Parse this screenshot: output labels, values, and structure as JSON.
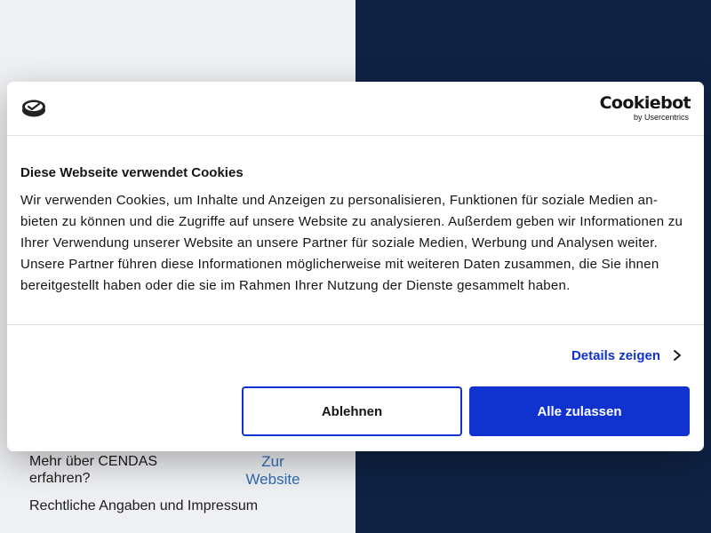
{
  "background": {
    "footer": {
      "more_text": "Mehr über CENDAS erfahren?",
      "website_link": "Zur Website",
      "legal_link": "Rechtliche Angaben und Impressum"
    }
  },
  "cookie_dialog": {
    "brand_logo_icon": "site-logo-icon",
    "cookiebot": {
      "name": "Cookiebot",
      "by": "by Usercentrics"
    },
    "title": "Diese Webseite verwendet Cookies",
    "text": "Wir verwenden Cookies, um Inhalte und Anzeigen zu personalisieren, Funktionen für soziale Medien an­bieten zu können und die Zugriffe auf unsere Website zu analysieren. Außerdem geben wir Informationen zu Ihrer Verwendung unserer Website an unsere Partner für soziale Medien, Werbung und Analysen wei­ter. Unsere Partner führen diese Informationen möglicherweise mit weiteren Daten zusammen, die Sie ih­nen bereitgestellt haben oder die sie im Rahmen Ihrer Nutzung der Dienste gesammelt haben.",
    "details_label": "Details zeigen",
    "details_icon": "chevron-right-icon",
    "decline_label": "Ablehnen",
    "accept_label": "Alle zulassen"
  },
  "colors": {
    "accent": "#1032cf",
    "background_left": "#eef0f3",
    "background_right": "#0f2244",
    "link": "#2f6db5"
  }
}
